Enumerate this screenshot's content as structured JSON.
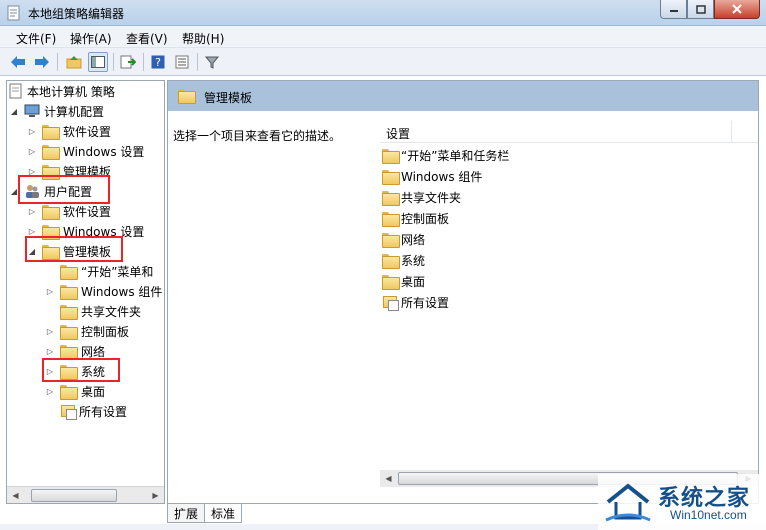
{
  "window": {
    "title": "本地组策略编辑器"
  },
  "menu": [
    "文件(F)",
    "操作(A)",
    "查看(V)",
    "帮助(H)"
  ],
  "toolbar": [
    "back-icon",
    "forward-icon",
    "up-folder-icon",
    "show-hide-tree-icon",
    "export-list-icon",
    "help-icon",
    "properties-icon",
    "filter-icon"
  ],
  "tree": {
    "root": "本地计算机 策略",
    "computer_config": "计算机配置",
    "c_software": "软件设置",
    "c_windows": "Windows 设置",
    "c_admin": "管理模板",
    "user_config": "用户配置",
    "u_software": "软件设置",
    "u_windows": "Windows 设置",
    "u_admin": "管理模板",
    "admin_children": [
      "“开始”菜单和",
      "Windows 组件",
      "共享文件夹",
      "控制面板",
      "网络",
      "系统",
      "桌面",
      "所有设置"
    ]
  },
  "right": {
    "header": "管理模板",
    "description": "选择一个项目来查看它的描述。",
    "column": "设置",
    "items": [
      "“开始”菜单和任务栏",
      "Windows 组件",
      "共享文件夹",
      "控制面板",
      "网络",
      "系统",
      "桌面",
      "所有设置"
    ]
  },
  "tabs": [
    "扩展",
    "标准"
  ],
  "watermark": {
    "brand": "系统之家",
    "url": "Win10net.com"
  },
  "colors": {
    "highlight": "#e8262a",
    "header_bg": "#aac1dc",
    "folder": "#efc862"
  }
}
